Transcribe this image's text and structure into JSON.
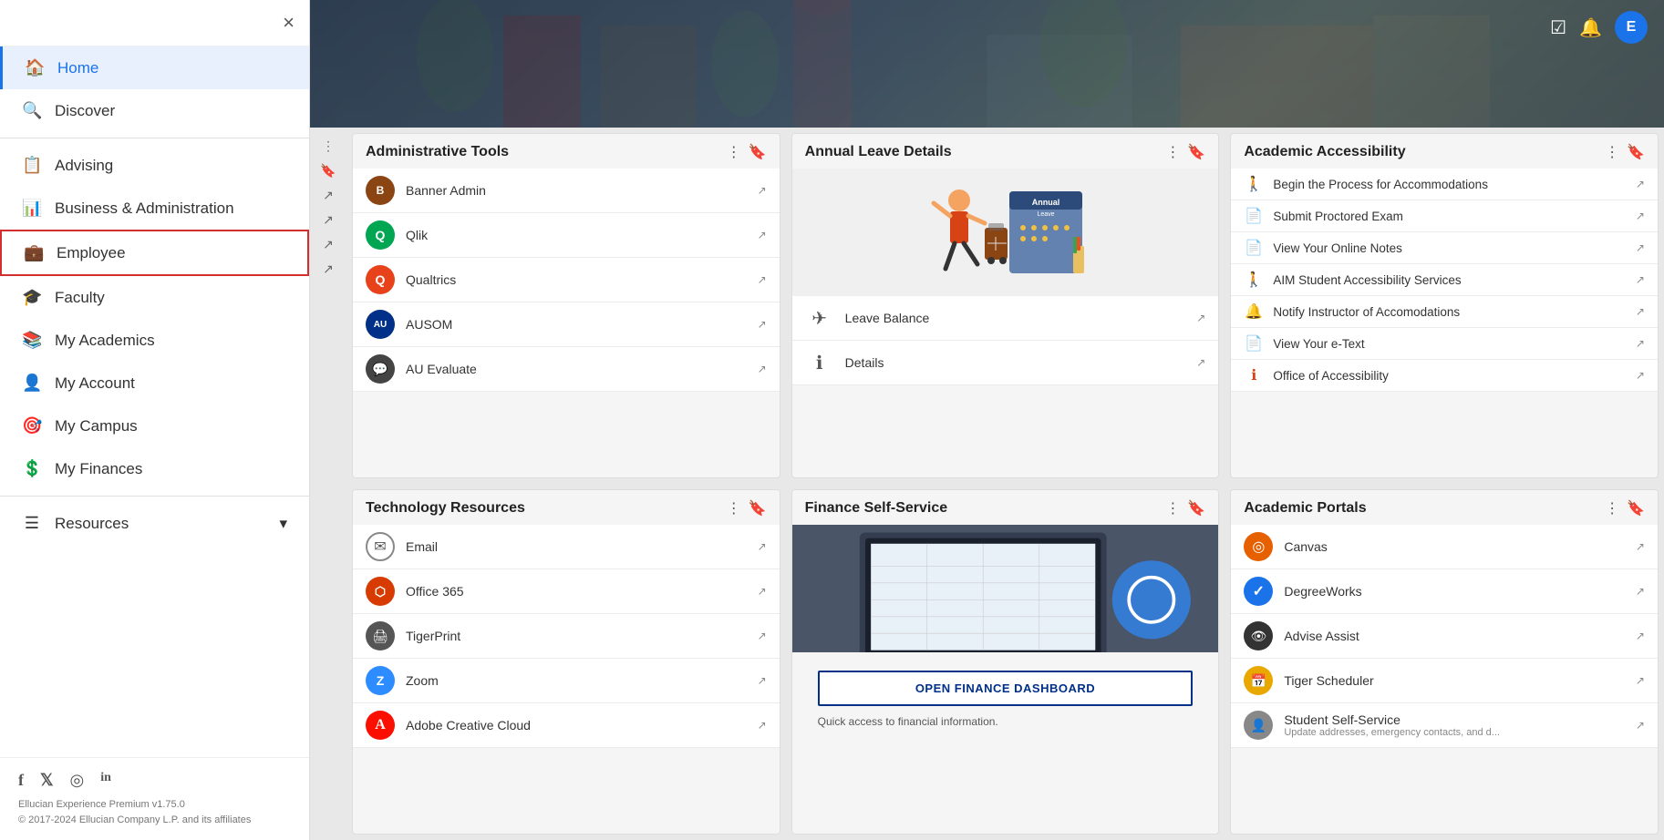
{
  "sidebar": {
    "close_label": "×",
    "nav_items": [
      {
        "id": "home",
        "label": "Home",
        "icon": "🏠",
        "active": true,
        "highlighted": false
      },
      {
        "id": "discover",
        "label": "Discover",
        "icon": "🔍",
        "active": false,
        "highlighted": false
      }
    ],
    "categories": [
      {
        "id": "advising",
        "label": "Advising",
        "icon": "📋",
        "highlighted": false
      },
      {
        "id": "business",
        "label": "Business & Administration",
        "icon": "📊",
        "highlighted": false
      },
      {
        "id": "employee",
        "label": "Employee",
        "icon": "💼",
        "highlighted": true
      },
      {
        "id": "faculty",
        "label": "Faculty",
        "icon": "🎓",
        "highlighted": false
      },
      {
        "id": "my-academics",
        "label": "My Academics",
        "icon": "📚",
        "highlighted": false
      },
      {
        "id": "my-account",
        "label": "My Account",
        "icon": "👤",
        "highlighted": false
      },
      {
        "id": "my-campus",
        "label": "My Campus",
        "icon": "🎯",
        "highlighted": false
      },
      {
        "id": "my-finances",
        "label": "My Finances",
        "icon": "💲",
        "highlighted": false
      }
    ],
    "resources": {
      "label": "Resources",
      "icon": "☰"
    },
    "social": [
      {
        "id": "facebook",
        "icon": "f",
        "label": "Facebook"
      },
      {
        "id": "twitter",
        "icon": "𝕏",
        "label": "Twitter/X"
      },
      {
        "id": "instagram",
        "icon": "◎",
        "label": "Instagram"
      },
      {
        "id": "linkedin",
        "icon": "in",
        "label": "LinkedIn"
      }
    ],
    "footer_line1": "Ellucian Experience Premium v1.75.0",
    "footer_line2": "© 2017-2024 Ellucian Company L.P. and its affiliates"
  },
  "topbar": {
    "avatar_letter": "E"
  },
  "cards": {
    "administrative_tools": {
      "title": "Administrative Tools",
      "items": [
        {
          "id": "banner-admin",
          "label": "Banner Admin",
          "icon_class": "icon-banner",
          "icon_char": "🅱"
        },
        {
          "id": "qlik",
          "label": "Qlik",
          "icon_class": "icon-qlik",
          "icon_char": "Q"
        },
        {
          "id": "qualtrics",
          "label": "Qualtrics",
          "icon_class": "icon-qualtrics",
          "icon_char": "Q"
        },
        {
          "id": "ausom",
          "label": "AUSOM",
          "icon_class": "icon-ausom",
          "icon_char": "AU"
        },
        {
          "id": "au-evaluate",
          "label": "AU Evaluate",
          "icon_class": "icon-auevaluate",
          "icon_char": "💬"
        }
      ]
    },
    "annual_leave": {
      "title": "Annual Leave Details",
      "items": [
        {
          "id": "leave-balance",
          "label": "Leave Balance",
          "icon_char": "✈"
        },
        {
          "id": "details",
          "label": "Details",
          "icon_char": "ℹ"
        }
      ]
    },
    "academic_accessibility": {
      "title": "Academic Accessibility",
      "items": [
        {
          "id": "begin-accommodations",
          "label": "Begin the Process for Accommodations",
          "icon_char": "🚶",
          "icon_color": "icon-walk"
        },
        {
          "id": "submit-proctored",
          "label": "Submit Proctored Exam",
          "icon_char": "📄",
          "icon_color": "icon-pdf"
        },
        {
          "id": "view-online-notes",
          "label": "View Your Online Notes",
          "icon_char": "📄",
          "icon_color": "icon-pdf"
        },
        {
          "id": "aim-student",
          "label": "AIM Student Accessibility Services",
          "icon_char": "🚶",
          "icon_color": "icon-walk"
        },
        {
          "id": "notify-instructor",
          "label": "Notify Instructor of Accomodations",
          "icon_char": "🔔",
          "icon_color": "icon-bell"
        },
        {
          "id": "view-etext",
          "label": "View Your e-Text",
          "icon_char": "📄",
          "icon_color": "icon-pdf"
        },
        {
          "id": "office-accessibility",
          "label": "Office of Accessibility",
          "icon_char": "ℹ",
          "icon_color": "icon-info"
        }
      ]
    },
    "technology_resources": {
      "title": "Technology Resources",
      "items": [
        {
          "id": "email",
          "label": "Email",
          "icon_class": "icon-email",
          "icon_char": "✉"
        },
        {
          "id": "office365",
          "label": "Office 365",
          "icon_class": "icon-office365",
          "icon_char": "⬡"
        },
        {
          "id": "tigerprint",
          "label": "TigerPrint",
          "icon_class": "icon-tigerprint",
          "icon_char": "🖨"
        },
        {
          "id": "zoom",
          "label": "Zoom",
          "icon_class": "icon-zoom",
          "icon_char": "Z"
        },
        {
          "id": "adobe",
          "label": "Adobe Creative Cloud",
          "icon_class": "icon-adobe",
          "icon_char": "A"
        }
      ]
    },
    "finance_self_service": {
      "title": "Finance Self-Service",
      "dashboard_btn": "OPEN FINANCE DASHBOARD",
      "caption": "Quick access to financial information."
    },
    "academic_portals": {
      "title": "Academic Portals",
      "items": [
        {
          "id": "canvas",
          "label": "Canvas",
          "icon_class": "icon-canvas",
          "icon_char": "◎"
        },
        {
          "id": "degreeworks",
          "label": "DegreeWorks",
          "icon_class": "icon-degreeworks",
          "icon_char": "✓"
        },
        {
          "id": "advise-assist",
          "label": "Advise Assist",
          "icon_class": "icon-adviseassist",
          "icon_char": "👁"
        },
        {
          "id": "tiger-scheduler",
          "label": "Tiger Scheduler",
          "icon_class": "icon-tigerscheduler",
          "icon_char": "📅"
        },
        {
          "id": "student-self-service",
          "label": "Student Self-Service",
          "icon_class": "icon-selfservice",
          "icon_char": "👤"
        }
      ],
      "student_self_service_caption": "Update addresses, emergency contacts, and d..."
    }
  }
}
